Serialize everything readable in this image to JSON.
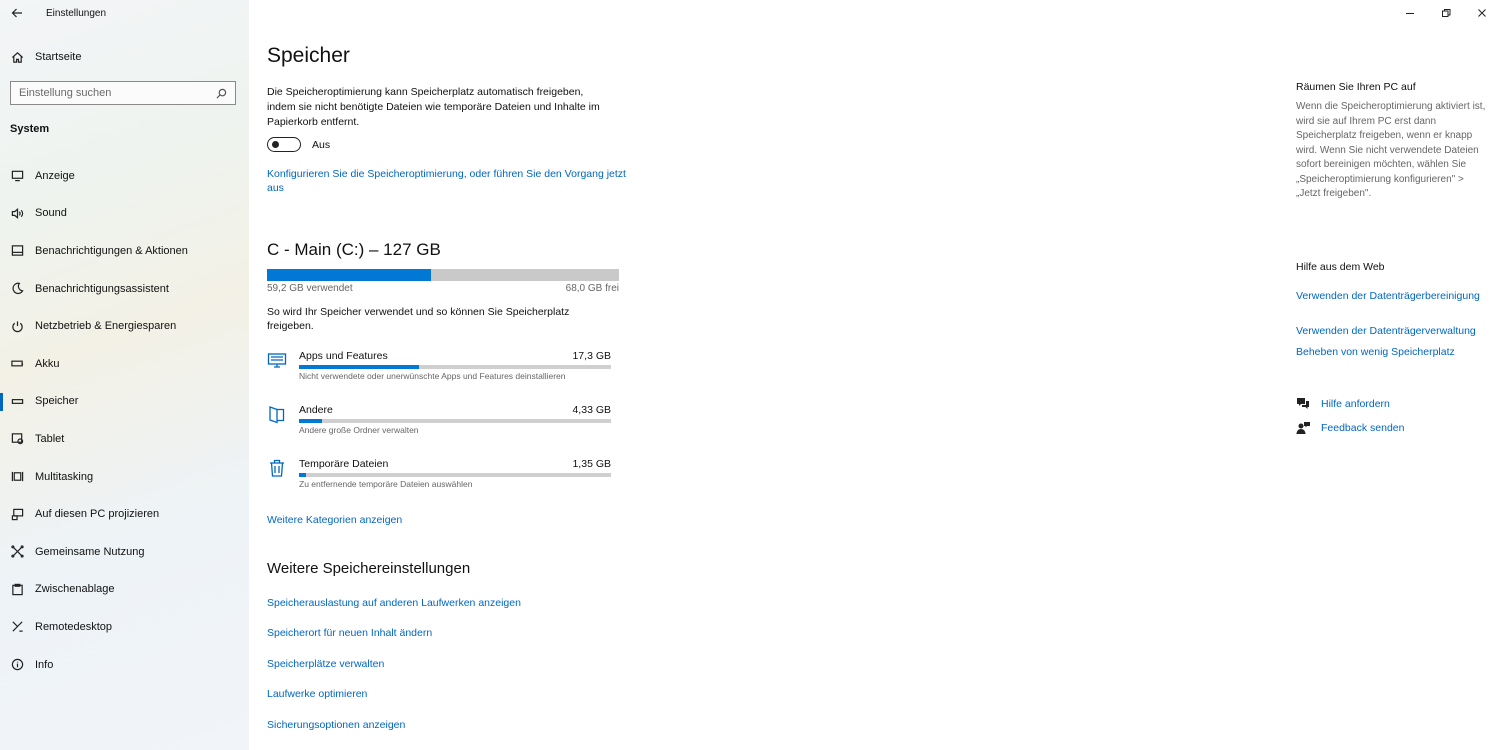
{
  "window": {
    "title": "Einstellungen",
    "controls": [
      "minimize-icon",
      "restore-icon",
      "close-icon"
    ]
  },
  "sidebar": {
    "home_label": "Startseite",
    "search_placeholder": "Einstellung suchen",
    "section": "System",
    "items": [
      {
        "label": "Anzeige",
        "icon": "display-icon"
      },
      {
        "label": "Sound",
        "icon": "speaker-icon"
      },
      {
        "label": "Benachrichtigungen & Aktionen",
        "icon": "notification-icon"
      },
      {
        "label": "Benachrichtigungsassistent",
        "icon": "moon-icon"
      },
      {
        "label": "Netzbetrieb & Energiesparen",
        "icon": "power-icon"
      },
      {
        "label": "Akku",
        "icon": "battery-icon"
      },
      {
        "label": "Speicher",
        "icon": "storage-icon",
        "active": true
      },
      {
        "label": "Tablet",
        "icon": "tablet-icon"
      },
      {
        "label": "Multitasking",
        "icon": "multitasking-icon"
      },
      {
        "label": "Auf diesen PC projizieren",
        "icon": "project-icon"
      },
      {
        "label": "Gemeinsame Nutzung",
        "icon": "share-icon"
      },
      {
        "label": "Zwischenablage",
        "icon": "clipboard-icon"
      },
      {
        "label": "Remotedesktop",
        "icon": "remote-icon"
      },
      {
        "label": "Info",
        "icon": "info-icon"
      }
    ]
  },
  "main": {
    "title": "Speicher",
    "intro": "Die Speicheroptimierung kann Speicherplatz automatisch freigeben, indem sie nicht benötigte Dateien wie temporäre Dateien und Inhalte im Papierkorb entfernt.",
    "toggle_label": "Aus",
    "toggle_on": false,
    "config_link": "Konfigurieren Sie die Speicheroptimierung, oder führen Sie den Vorgang jetzt aus",
    "drive": {
      "title": "C - Main (C:) – 127 GB",
      "used_label": "59,2 GB verwendet",
      "free_label": "68,0 GB frei",
      "used_fraction": 0.466
    },
    "usage_text": "So wird Ihr Speicher verwendet und so können Sie Speicherplatz freigeben.",
    "categories": [
      {
        "name": "Apps und Features",
        "size": "17,3 GB",
        "desc": "Nicht verwendete oder unerwünschte Apps und Features deinstallieren",
        "fraction": 0.384,
        "icon": "apps-icon"
      },
      {
        "name": "Andere",
        "size": "4,33 GB",
        "desc": "Andere große Ordner verwalten",
        "fraction": 0.073,
        "icon": "folder-icon"
      },
      {
        "name": "Temporäre Dateien",
        "size": "1,35 GB",
        "desc": "Zu entfernende temporäre Dateien auswählen",
        "fraction": 0.022,
        "icon": "trash-icon"
      }
    ],
    "more_categories": "Weitere Kategorien anzeigen",
    "more_settings_title": "Weitere Speichereinstellungen",
    "more_settings_links": [
      "Speicherauslastung auf anderen Laufwerken anzeigen",
      "Speicherort für neuen Inhalt ändern",
      "Speicherplätze verwalten",
      "Laufwerke optimieren",
      "Sicherungsoptionen anzeigen"
    ]
  },
  "right": {
    "clean_title": "Räumen Sie Ihren PC auf",
    "clean_text": "Wenn die Speicheroptimierung aktiviert ist, wird sie auf Ihrem PC erst dann Speicherplatz freigeben, wenn er knapp wird. Wenn Sie nicht verwendete Dateien sofort bereinigen möchten, wählen Sie „Speicheroptimierung konfigurieren\" > „Jetzt freigeben\".",
    "web_title": "Hilfe aus dem Web",
    "web_links": [
      "Verwenden der Datenträgerbereinigung",
      "Verwenden der Datenträgerverwaltung",
      "Beheben von wenig Speicherplatz"
    ],
    "help_label": "Hilfe anfordern",
    "feedback_label": "Feedback senden"
  }
}
